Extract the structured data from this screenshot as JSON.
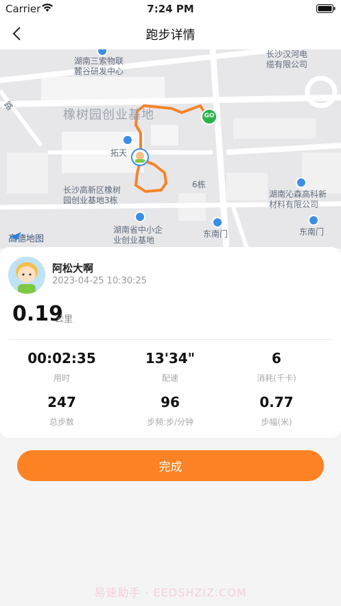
{
  "status": {
    "carrier": "Carrier",
    "time": "7:24 PM"
  },
  "nav": {
    "title": "跑步详情"
  },
  "map": {
    "labels": {
      "l1": "湖南三索物联\n麓谷研发中心",
      "l2": "长沙汉河电\n缆有限公司",
      "l3": "橡树园创业基地",
      "l4": "拓天",
      "l5": "长沙高新区橡树\n园创业基地3栋",
      "l6": "6栋",
      "l7": "湖南沁森高科新\n材料有限公司",
      "l8": "湖南省中小企\n业创业基地",
      "l9": "东南门",
      "l10": "东南门",
      "l11": "路"
    },
    "go_label": "GO",
    "logo_text": "高德地图"
  },
  "user": {
    "name": "阿松大啊",
    "datetime": "2023-04-25 10:30:25"
  },
  "distance": {
    "value": "0.19",
    "unit": "公里"
  },
  "stats": [
    {
      "value": "00:02:35",
      "label": "用时"
    },
    {
      "value": "13'34\"",
      "label": "配速"
    },
    {
      "value": "6",
      "label": "消耗(千卡)"
    },
    {
      "value": "247",
      "label": "总步数"
    },
    {
      "value": "96",
      "label": "步频:步/分钟"
    },
    {
      "value": "0.77",
      "label": "步幅(米)"
    }
  ],
  "finish_label": "完成",
  "watermark": "易速助手 · EEDSHZIZ.COM",
  "colors": {
    "accent": "#fd8224",
    "route": "#f4842a",
    "go": "#2bb34a"
  }
}
